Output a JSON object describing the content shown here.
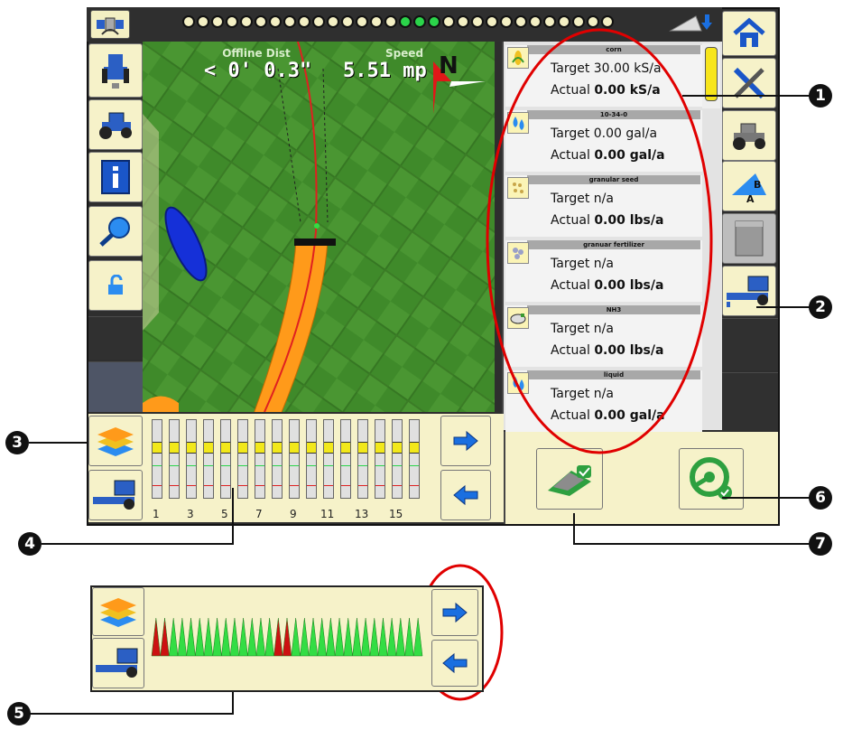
{
  "map": {
    "offline_label": "Offline Dist",
    "offline_value": "< 0' 0.3\"",
    "speed_label": "Speed",
    "speed_value": "5.51 mp",
    "compass": "N"
  },
  "products": [
    {
      "name": "corn",
      "target": "Target  30.00 kS/a",
      "actual_label": "Actual",
      "actual_value": "0.00 kS/a",
      "icon": "corn-icon"
    },
    {
      "name": "10-34-0",
      "target": "Target  0.00 gal/a",
      "actual_label": "Actual",
      "actual_value": "0.00 gal/a",
      "icon": "liquid-drops-icon"
    },
    {
      "name": "granular seed",
      "target": "Target  n/a",
      "actual_label": "Actual",
      "actual_value": "0.00 lbs/a",
      "icon": "granular-seed-icon"
    },
    {
      "name": "granuar fertilizer",
      "target": "Target  n/a",
      "actual_label": "Actual",
      "actual_value": "0.00 lbs/a",
      "icon": "fertilizer-icon"
    },
    {
      "name": "NH3",
      "target": "Target  n/a",
      "actual_label": "Actual",
      "actual_value": "0.00 lbs/a",
      "icon": "nh3-tank-icon"
    },
    {
      "name": "liquid",
      "target": "Target  n/a",
      "actual_label": "Actual",
      "actual_value": "0.00 gal/a",
      "icon": "liquid-drops-icon"
    }
  ],
  "section_ticks": [
    "1",
    "3",
    "5",
    "7",
    "9",
    "11",
    "13",
    "15"
  ],
  "callouts": [
    "1",
    "2",
    "3",
    "4",
    "5",
    "6",
    "7"
  ],
  "colors": {
    "panel": "#f6f2c9",
    "field": "#3f8a2a",
    "coverage": "#ff9a1a",
    "guidance": "#e02020",
    "active_row": "#33dd44",
    "inactive_row": "#cc1111",
    "highlight": "#e00000",
    "arrow": "#1a6fe0"
  },
  "gps_status": {
    "total": 30,
    "active": [
      15,
      16,
      17
    ]
  },
  "inset_rows": {
    "count": 31,
    "red": [
      0,
      1,
      14,
      15
    ]
  }
}
